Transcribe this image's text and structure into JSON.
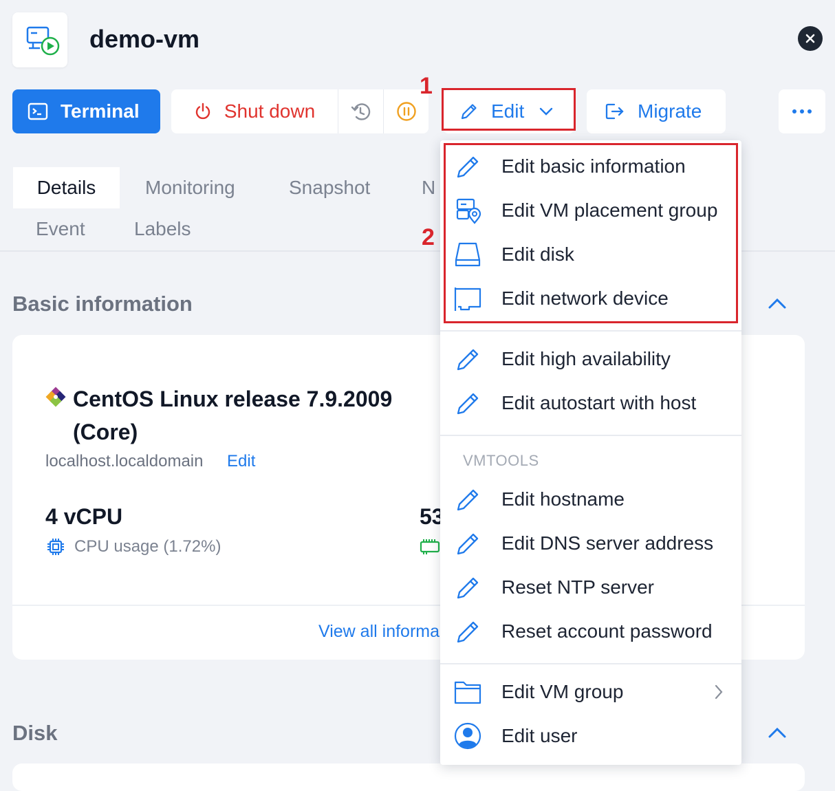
{
  "header": {
    "title": "demo-vm"
  },
  "toolbar": {
    "terminal": "Terminal",
    "shutdown": "Shut down",
    "edit": "Edit",
    "migrate": "Migrate"
  },
  "annotations": {
    "one": "1",
    "two": "2"
  },
  "tabs": {
    "details": "Details",
    "monitoring": "Monitoring",
    "snapshot": "Snapshot",
    "partial": "N",
    "event": "Event",
    "labels": "Labels"
  },
  "basic_info": {
    "title": "Basic information",
    "os": "CentOS Linux release 7.9.2009 (Core)",
    "hostname": "localhost.localdomain",
    "hostname_edit": "Edit",
    "vcpu": "4 vCPU",
    "cpu_usage": "CPU usage  (1.72%)",
    "mem_partial": "53",
    "view_all": "View all informa"
  },
  "disk": {
    "title": "Disk"
  },
  "edit_menu": {
    "group1": [
      {
        "label": "Edit basic information",
        "icon": "pencil-icon"
      },
      {
        "label": "Edit VM placement group",
        "icon": "placement-group-icon"
      },
      {
        "label": "Edit disk",
        "icon": "disk-icon"
      },
      {
        "label": "Edit network device",
        "icon": "network-card-icon"
      }
    ],
    "group2": [
      {
        "label": "Edit high availability",
        "icon": "pencil-icon"
      },
      {
        "label": "Edit autostart with host",
        "icon": "pencil-icon"
      }
    ],
    "vmtools_header": "VMTOOLS",
    "group3": [
      {
        "label": "Edit hostname",
        "icon": "pencil-icon"
      },
      {
        "label": "Edit DNS server address",
        "icon": "pencil-icon"
      },
      {
        "label": "Reset NTP server",
        "icon": "pencil-icon"
      },
      {
        "label": "Reset account password",
        "icon": "pencil-icon"
      }
    ],
    "group4": [
      {
        "label": "Edit VM group",
        "icon": "folder-icon"
      },
      {
        "label": "Edit user",
        "icon": "user-icon"
      }
    ]
  },
  "colors": {
    "primary": "#1f7aeb",
    "danger": "#e0332e",
    "warning": "#f0a020",
    "annotation": "#d9252c"
  }
}
